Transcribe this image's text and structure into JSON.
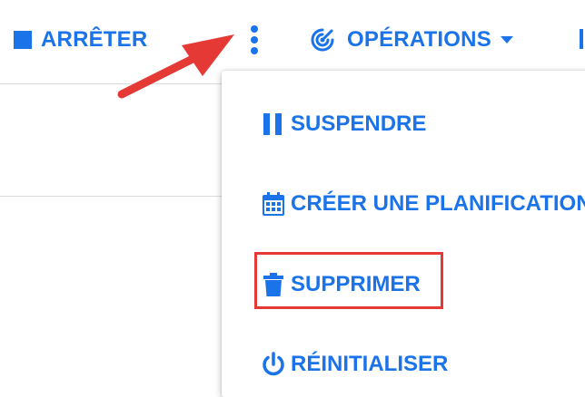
{
  "toolbar": {
    "stop_label": "ARRÊTER",
    "operations_label": "OPÉRATIONS"
  },
  "menu": {
    "items": [
      {
        "label": "SUSPENDRE",
        "icon": "pause-icon"
      },
      {
        "label": "CRÉER UNE PLANIFICATION",
        "icon": "calendar-icon"
      },
      {
        "label": "SUPPRIMER",
        "icon": "trash-icon"
      },
      {
        "label": "RÉINITIALISER",
        "icon": "power-icon"
      }
    ]
  },
  "colors": {
    "accent": "#1a73e8",
    "annotation": "#e53935",
    "divider": "#dadce0"
  }
}
